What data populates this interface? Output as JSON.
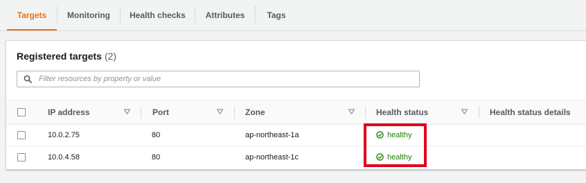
{
  "tabs": [
    {
      "label": "Targets",
      "active": true
    },
    {
      "label": "Monitoring",
      "active": false
    },
    {
      "label": "Health checks",
      "active": false
    },
    {
      "label": "Attributes",
      "active": false
    },
    {
      "label": "Tags",
      "active": false
    }
  ],
  "panel": {
    "title": "Registered targets",
    "count": "(2)"
  },
  "search": {
    "placeholder": "Filter resources by property or value",
    "value": ""
  },
  "table": {
    "columns": [
      "IP address",
      "Port",
      "Zone",
      "Health status",
      "Health status details"
    ],
    "rows": [
      {
        "ip": "10.0.2.75",
        "port": "80",
        "zone": "ap-northeast-1a",
        "health_status": "healthy",
        "health_status_details": ""
      },
      {
        "ip": "10.0.4.58",
        "port": "80",
        "zone": "ap-northeast-1c",
        "health_status": "healthy",
        "health_status_details": ""
      }
    ]
  },
  "colors": {
    "accent": "#ec7211",
    "healthy": "#1d8102",
    "highlight": "#e0001b"
  },
  "icons": {
    "search": "search-icon",
    "sort": "sort-down-icon",
    "healthy": "check-circle-icon"
  }
}
